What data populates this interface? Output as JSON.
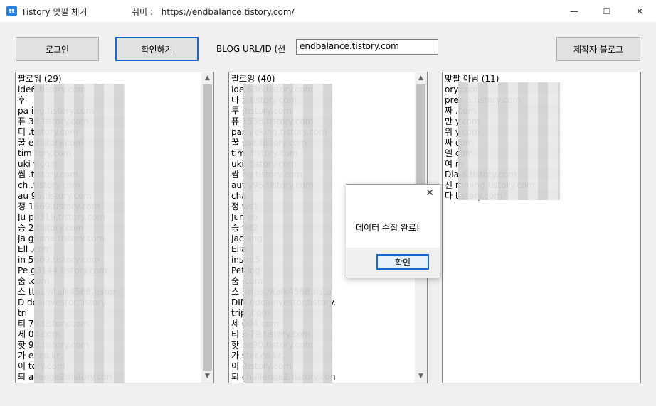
{
  "window": {
    "title": "Tistory 맞팔 체커",
    "hobby_label": "취미 :",
    "hobby_url": "https://endbalance.tistory.com/",
    "icon": "tistory-app-icon",
    "minimize_glyph": "—",
    "maximize_glyph": "☐",
    "close_glyph": "✕"
  },
  "toolbar": {
    "login_label": "로그인",
    "check_label": "확인하기",
    "blog_label": "BLOG URL/ID (선",
    "blog_value": "endbalance.tistory.com",
    "author_label": "제작자 블로그"
  },
  "followers": {
    "header": "팔로워 (29)",
    "items": [
      "ide6.tistory.com",
      "후",
      "pa  ing.tistory.com",
      "퓨  38.tistory.com",
      "디  .tistory.com",
      "꿀  e.tistory.com",
      "tim  tory.com",
      "uki  y.com",
      "씸  .tistory.com",
      "ch  .tistory.com",
      "au  95.tistory.com",
      "정  1669.tistory.com",
      "Ju  p0319.tistory.com",
      "승  2.tistory.com",
      "Ja  ghona.tistory.com",
      "Ell  .com",
      "in  5669.tistory.com",
      "Pe  g3144.tistory.com",
      "숨  .com",
      "스  ttps://talk4568.tistor",
      "D  dcainvestor.tistory.",
      "tri  ",
      "티  79.tistory.com",
      "세  04.com",
      "핫  90.tistory.com",
      "가  er.co.kr",
      "이  tory.com",
      "퇴  allenge2.tistory.con"
    ]
  },
  "followings": {
    "header": "팔로잉 (40)",
    "items": [
      "ide  636.tistory.com",
      "다  p.tistory.com",
      "투  .tistory.com",
      "퓨  1538.tistory.com",
      "pas  yeking.tistory.com",
      "꿀  use.tistory.com",
      "tim  .tistory.com",
      "uki  .tistory.com",
      "쌈  ng.tistory.com",
      "aut  y95.tistory.com",
      "cha  ",
      "정  ws1",
      "Jun  eo",
      "승  982",
      "Jac  ang",
      "Ella  ",
      "ins  nt5",
      "Pet  log",
      "숨  .com",
      "스  https://talk4568.tisto",
      "DIN  //dcainvestor.tistory.",
      "trip  .com",
      "세  004.com",
      "티  k-79.tistory.com",
      "핫  ne90.tistory.com",
      "가  ster.co.kr",
      "이  .tistory.com",
      "퇴  challenge2.tistory.con"
    ]
  },
  "non_mutual": {
    "header": "맞팔 아님 (11)",
    "items": [
      "  ory.com",
      "pres  6.tistory.com",
      "짜  .com",
      "만  y.com",
      "위  y.com",
      "싸  com",
      "엘  com",
      "여  m",
      "Dia  a.tistory.com",
      "신  mming.tistory.com",
      "다  tistory.com"
    ]
  },
  "dialog": {
    "message": "데이터 수집 완료!",
    "ok_label": "확인",
    "close_glyph": "✕"
  },
  "scroll": {
    "up_glyph": "▲",
    "down_glyph": "▼"
  }
}
